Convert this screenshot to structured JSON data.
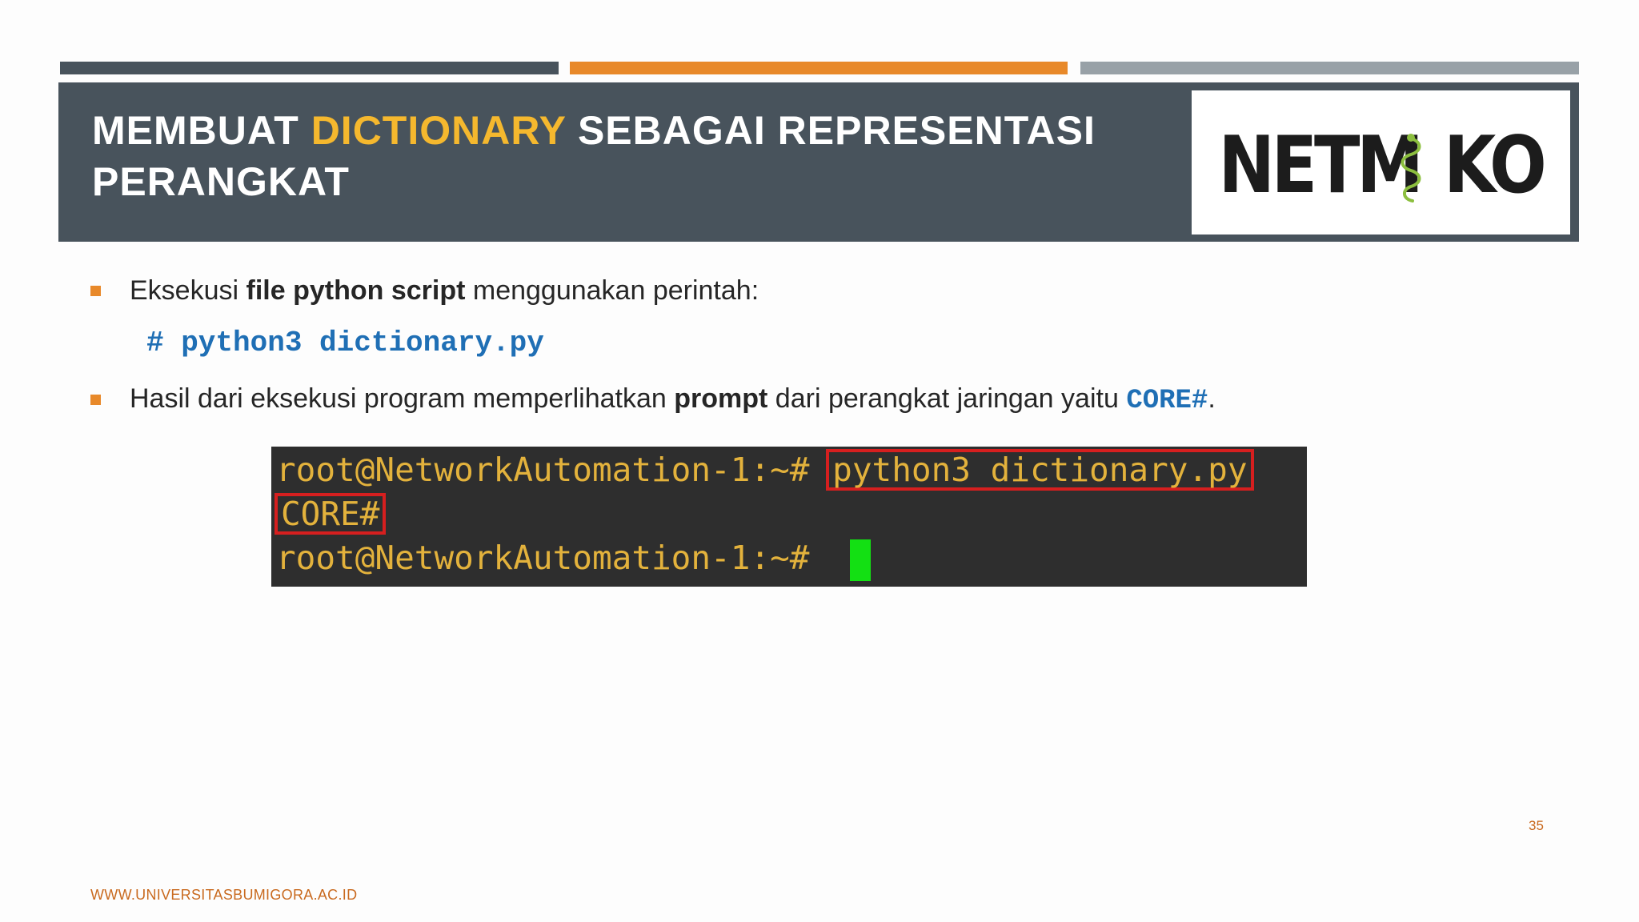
{
  "slide": {
    "title_part1": "MEMBUAT ",
    "title_highlight": "DICTIONARY",
    "title_part2": " SEBAGAI REPRESENTASI PERANGKAT",
    "logo_text_left": "NETM",
    "logo_text_right": "KO",
    "bullets": [
      {
        "prefix": "Eksekusi ",
        "bold": "file python script",
        "suffix": " menggunakan perintah:"
      },
      {
        "prefix": "Hasil dari eksekusi program memperlihatkan ",
        "bold": "prompt",
        "middle": " dari perangkat jaringan yaitu ",
        "code": "CORE#",
        "suffix": "."
      }
    ],
    "command": "# python3 dictionary.py",
    "terminal": {
      "prompt_1": "root@NetworkAutomation-1:~# ",
      "command_1": "python3 dictionary.py",
      "output": "CORE#",
      "prompt_2": "root@NetworkAutomation-1:~# "
    },
    "page_number": "35",
    "footer_url": "WWW.UNIVERSITASBUMIGORA.AC.ID"
  },
  "colors": {
    "band": "#48535c",
    "accent_orange": "#e8892a",
    "title_highlight": "#f5b82e",
    "code_blue": "#1f6fb5",
    "terminal_bg": "#2e2e2e",
    "terminal_text": "#e3b23c",
    "highlight_box": "#d61f1f",
    "cursor": "#13e013"
  }
}
